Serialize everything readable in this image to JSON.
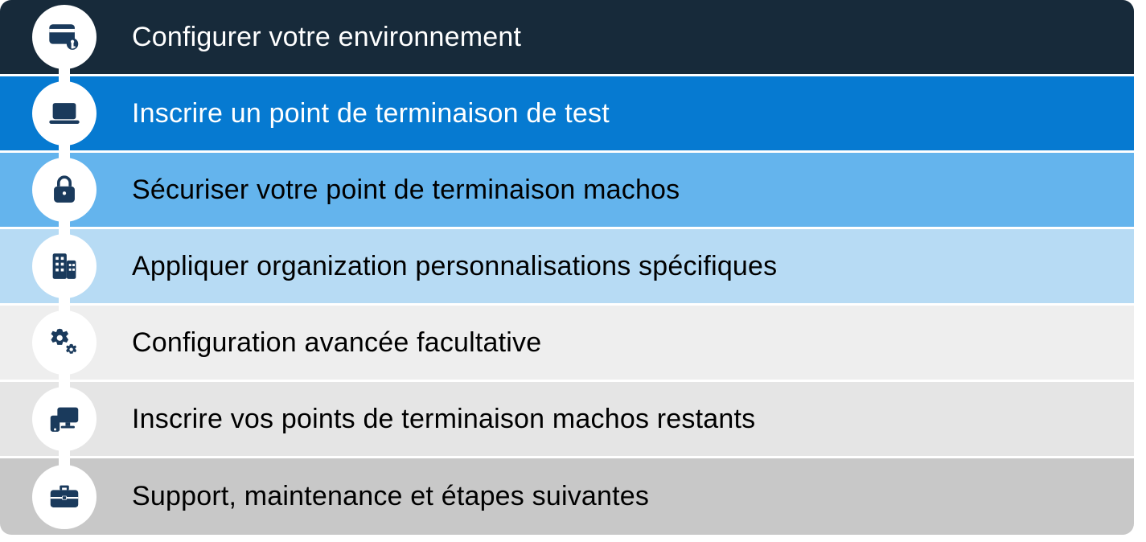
{
  "steps": [
    {
      "label": "Configurer votre environnement",
      "icon": "card-key-icon"
    },
    {
      "label": "Inscrire un point de terminaison de test",
      "icon": "laptop-icon"
    },
    {
      "label": "Sécuriser votre point de terminaison machos",
      "icon": "lock-icon"
    },
    {
      "label": "Appliquer organization personnalisations spécifiques",
      "icon": "building-icon"
    },
    {
      "label": "Configuration avancée facultative",
      "icon": "gears-icon"
    },
    {
      "label": "Inscrire vos points de terminaison machos restants",
      "icon": "devices-icon"
    },
    {
      "label": "Support, maintenance et étapes suivantes",
      "icon": "briefcase-icon"
    }
  ],
  "colors": {
    "icon_fill": "#1a3a5c",
    "step_backgrounds": [
      "#172a3a",
      "#067ad1",
      "#64b4ed",
      "#b7dbf4",
      "#eeeeee",
      "#e5e5e5",
      "#c8c8c8"
    ]
  }
}
